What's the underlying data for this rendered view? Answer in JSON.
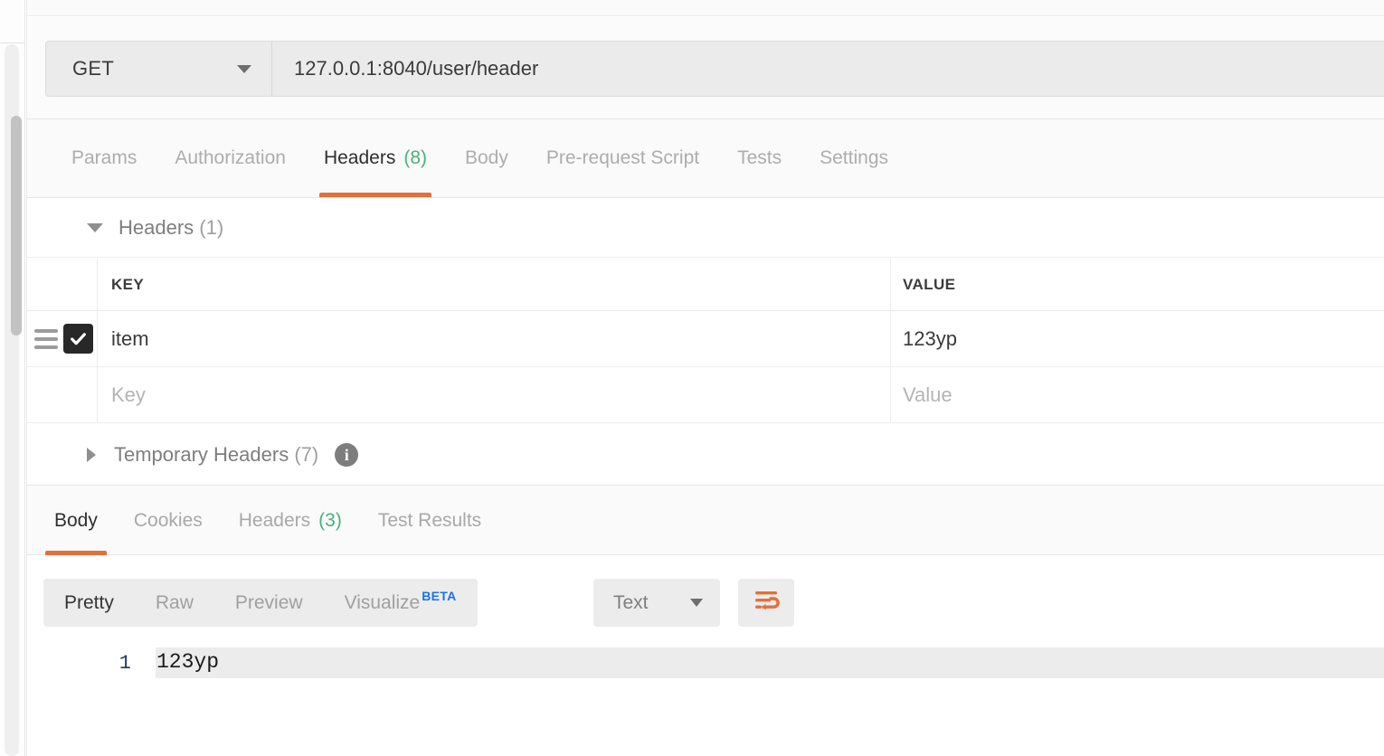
{
  "request": {
    "method": "GET",
    "method_icon": "chevron-down-icon",
    "url": "127.0.0.1:8040/user/header",
    "url_placeholder": "Enter request URL"
  },
  "request_tabs": [
    {
      "label": "Params",
      "count": "",
      "active": false
    },
    {
      "label": "Authorization",
      "count": "",
      "active": false
    },
    {
      "label": "Headers",
      "count": "(8)",
      "active": true
    },
    {
      "label": "Body",
      "count": "",
      "active": false
    },
    {
      "label": "Pre-request Script",
      "count": "",
      "active": false
    },
    {
      "label": "Tests",
      "count": "",
      "active": false
    },
    {
      "label": "Settings",
      "count": "",
      "active": false
    }
  ],
  "headers_section": {
    "title": "Headers",
    "count": "(1)",
    "expanded": true,
    "columns": {
      "key": "KEY",
      "value": "VALUE"
    },
    "rows": [
      {
        "checked": true,
        "key": "item",
        "value": "123yp"
      }
    ],
    "new_row": {
      "key_placeholder": "Key",
      "value_placeholder": "Value"
    }
  },
  "temporary_headers": {
    "title": "Temporary Headers",
    "count": "(7)",
    "expanded": false,
    "info_icon": "info-icon",
    "info_glyph": "i"
  },
  "response_tabs": [
    {
      "label": "Body",
      "count": "",
      "active": true
    },
    {
      "label": "Cookies",
      "count": "",
      "active": false
    },
    {
      "label": "Headers",
      "count": "(3)",
      "active": false
    },
    {
      "label": "Test Results",
      "count": "",
      "active": false
    }
  ],
  "body_toolbar": {
    "views": [
      {
        "label": "Pretty",
        "active": true,
        "badge": ""
      },
      {
        "label": "Raw",
        "active": false,
        "badge": ""
      },
      {
        "label": "Preview",
        "active": false,
        "badge": ""
      },
      {
        "label": "Visualize",
        "active": false,
        "badge": "BETA"
      }
    ],
    "format": "Text",
    "format_caret": "chevron-down-icon",
    "wrap_button_icon": "word-wrap-icon"
  },
  "response_body": {
    "line_number": "1",
    "content": "123yp"
  },
  "colors": {
    "accent": "#e2703a",
    "count_green": "#4caf7d",
    "beta_blue": "#1a73e8",
    "line_number_blue": "#1f3a68",
    "checkbox_dark": "#282828"
  }
}
